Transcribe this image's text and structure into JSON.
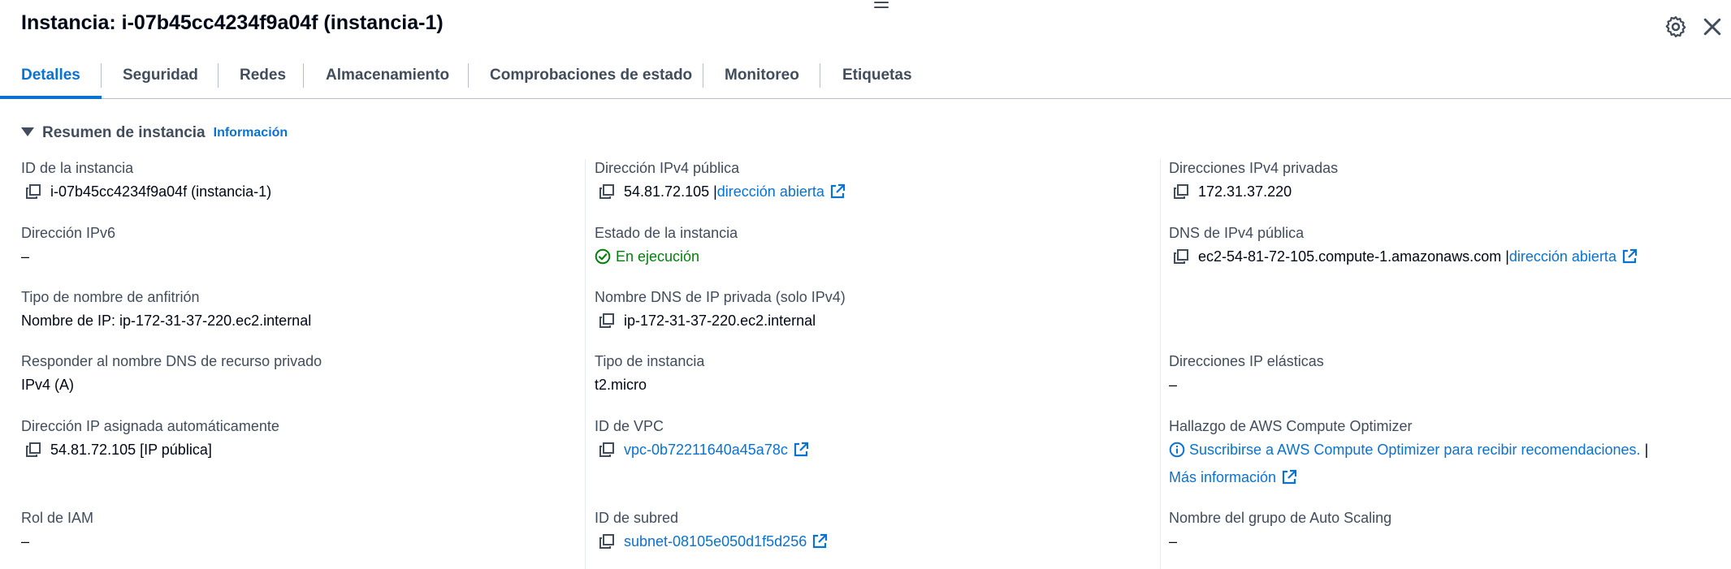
{
  "header": {
    "title": "Instancia: i-07b45cc4234f9a04f (instancia-1)"
  },
  "tabs": [
    {
      "label": "Detalles"
    },
    {
      "label": "Seguridad"
    },
    {
      "label": "Redes"
    },
    {
      "label": "Almacenamiento"
    },
    {
      "label": "Comprobaciones de estado"
    },
    {
      "label": "Monitoreo"
    },
    {
      "label": "Etiquetas"
    }
  ],
  "section": {
    "title": "Resumen de instancia",
    "info_link": "Información"
  },
  "fields": {
    "instance_id": {
      "label": "ID de la instancia",
      "value": "i-07b45cc4234f9a04f (instancia-1)"
    },
    "ipv6": {
      "label": "Dirección IPv6",
      "value": "–"
    },
    "hostname_type": {
      "label": "Tipo de nombre de anfitrión",
      "value": "Nombre de IP: ip-172-31-37-220.ec2.internal"
    },
    "private_dns_answer": {
      "label": "Responder al nombre DNS de recurso privado",
      "value": "IPv4 (A)"
    },
    "auto_ip": {
      "label": "Dirección IP asignada automáticamente",
      "value": "54.81.72.105 [IP pública]"
    },
    "iam_role": {
      "label": "Rol de IAM",
      "value": "–"
    },
    "public_ipv4": {
      "label": "Dirección IPv4 pública",
      "value": "54.81.72.105 |",
      "link": "dirección abierta"
    },
    "state": {
      "label": "Estado de la instancia",
      "value": "En ejecución"
    },
    "private_dns_name": {
      "label": "Nombre DNS de IP privada (solo IPv4)",
      "value": "ip-172-31-37-220.ec2.internal"
    },
    "instance_type": {
      "label": "Tipo de instancia",
      "value": "t2.micro"
    },
    "vpc_id": {
      "label": "ID de VPC",
      "value": "vpc-0b72211640a45a78c"
    },
    "subnet_id": {
      "label": "ID de subred",
      "value": "subnet-08105e050d1f5d256"
    },
    "private_ipv4": {
      "label": "Direcciones IPv4 privadas",
      "value": "172.31.37.220"
    },
    "public_dns": {
      "label": "DNS de IPv4 pública",
      "value": "ec2-54-81-72-105.compute-1.amazonaws.com |",
      "link": "dirección abierta"
    },
    "elastic_ip": {
      "label": "Direcciones IP elásticas",
      "value": "–"
    },
    "optimizer": {
      "label": "Hallazgo de AWS Compute Optimizer",
      "link": "Suscribirse a AWS Compute Optimizer para recibir recomendaciones.",
      "sep": " |",
      "more": "Más información"
    },
    "asg_name": {
      "label": "Nombre del grupo de Auto Scaling",
      "value": "–"
    }
  },
  "colors": {
    "link": "#0972d3",
    "success": "#037f0c",
    "label": "#414d5c",
    "text": "#000716"
  }
}
